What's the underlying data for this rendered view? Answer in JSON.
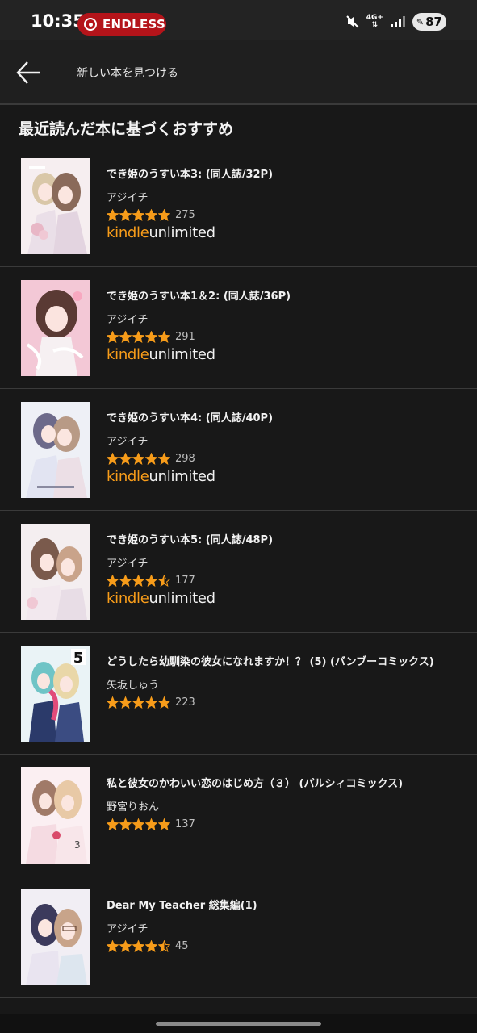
{
  "status_bar": {
    "time": "10:35",
    "badge_label": "ENDLESS",
    "network": "4G+",
    "battery": "87",
    "badge_color": "#b4141a"
  },
  "app_bar": {
    "title": "新しい本を見つける",
    "back_icon": "arrow-left-icon"
  },
  "section": {
    "title": "最近読んだ本に基づくおすすめ"
  },
  "kindle_unlimited": {
    "kindle": "kindle",
    "unlimited": "unlimited",
    "kindle_color": "#f79c1a"
  },
  "books": [
    {
      "title": "でき姫のうすい本3: (同人誌/32P)",
      "author": "アジイチ",
      "rating": 5,
      "rating_count": "275",
      "kindle_unlimited": true
    },
    {
      "title": "でき姫のうすい本1＆2: (同人誌/36P)",
      "author": "アジイチ",
      "rating": 5,
      "rating_count": "291",
      "kindle_unlimited": true
    },
    {
      "title": "でき姫のうすい本4: (同人誌/40P)",
      "author": "アジイチ",
      "rating": 5,
      "rating_count": "298",
      "kindle_unlimited": true
    },
    {
      "title": "でき姫のうすい本5: (同人誌/48P)",
      "author": "アジイチ",
      "rating": 4.5,
      "rating_count": "177",
      "kindle_unlimited": true
    },
    {
      "title": "どうしたら幼馴染の彼女になれますか！？ (5) (バンブーコミックス)",
      "author": "矢坂しゅう",
      "rating": 5,
      "rating_count": "223",
      "kindle_unlimited": false
    },
    {
      "title": "私と彼女のかわいい恋のはじめ方（３） (パルシィコミックス)",
      "author": "野宮りおん",
      "rating": 5,
      "rating_count": "137",
      "kindle_unlimited": false
    },
    {
      "title": "Dear My Teacher 総集編(1)",
      "author": "アジイチ",
      "rating": 4.5,
      "rating_count": "45",
      "kindle_unlimited": false
    }
  ],
  "colors": {
    "background": "#181818",
    "star": "#f79c1a",
    "divider": "#3a3a3a"
  }
}
